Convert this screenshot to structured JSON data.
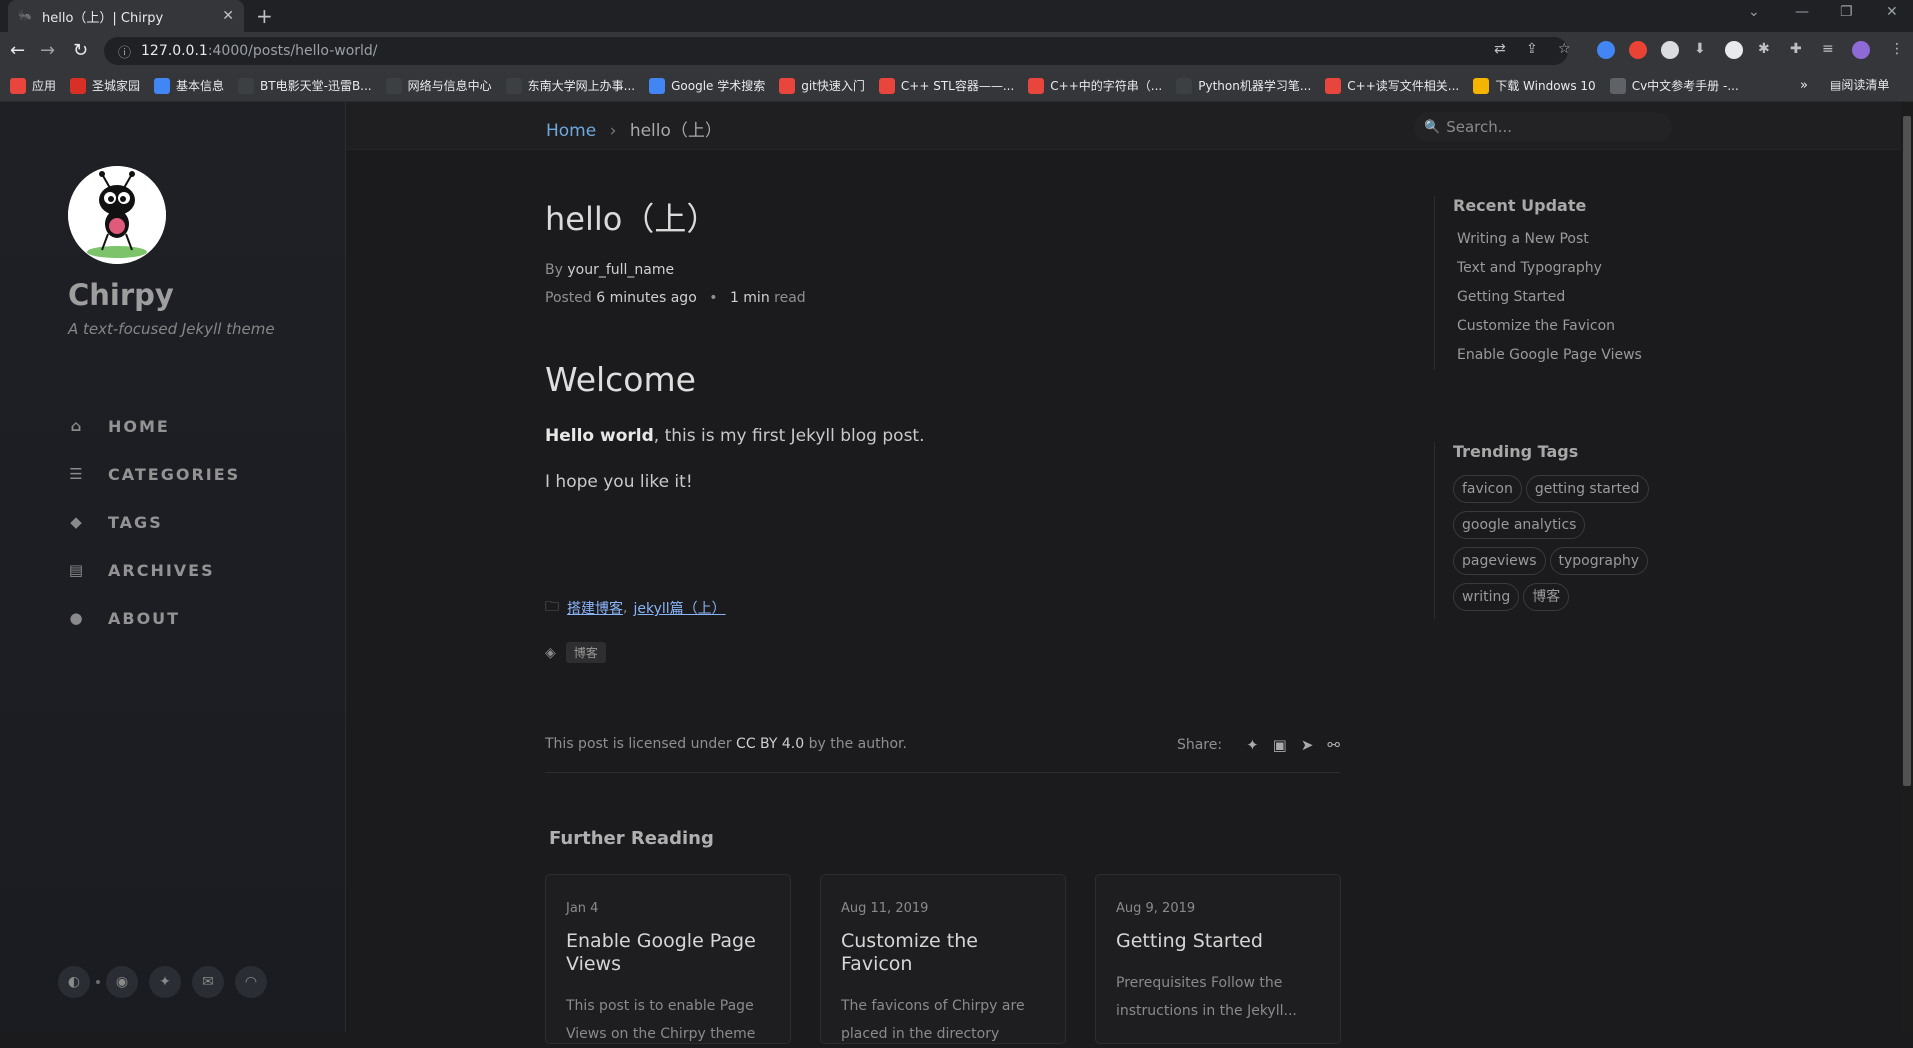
{
  "browser": {
    "tab_title": "hello（上）| Chirpy",
    "url_host": "127.0.0.1",
    "url_path": ":4000/posts/hello-world/",
    "bookmarks": [
      {
        "label": "应用",
        "color": "#e8453c"
      },
      {
        "label": "圣城家园",
        "color": "#d93025"
      },
      {
        "label": "基本信息",
        "color": "#4285f4"
      },
      {
        "label": "BT电影天堂-迅雷B...",
        "color": "#3c4043"
      },
      {
        "label": "网络与信息中心",
        "color": "#3c4043"
      },
      {
        "label": "东南大学网上办事...",
        "color": "#3c4043"
      },
      {
        "label": "Google 学术搜索",
        "color": "#4285f4"
      },
      {
        "label": "git快速入门",
        "color": "#e8453c"
      },
      {
        "label": "C++ STL容器——...",
        "color": "#e8453c"
      },
      {
        "label": "C++中的字符串（...",
        "color": "#e8453c"
      },
      {
        "label": "Python机器学习笔...",
        "color": "#3c4043"
      },
      {
        "label": "C++读写文件相关...",
        "color": "#e8453c"
      },
      {
        "label": "下载 Windows 10",
        "color": "#f4b400"
      },
      {
        "label": "Cv中文参考手册 -...",
        "color": "#5f6368"
      }
    ],
    "bookmarks_more": "»",
    "reading_list": "阅读清单"
  },
  "sidebar": {
    "site_title": "Chirpy",
    "site_subtitle": "A text-focused Jekyll theme",
    "nav": [
      {
        "label": "HOME",
        "icon": "home-icon"
      },
      {
        "label": "CATEGORIES",
        "icon": "stream-icon"
      },
      {
        "label": "TAGS",
        "icon": "tag-icon"
      },
      {
        "label": "ARCHIVES",
        "icon": "archive-icon"
      },
      {
        "label": "ABOUT",
        "icon": "info-icon"
      }
    ]
  },
  "topbar": {
    "breadcrumb_home": "Home",
    "breadcrumb_current": "hello（上）",
    "search_placeholder": "Search..."
  },
  "post": {
    "title": "hello（上）",
    "by_label": "By",
    "author": "your_full_name",
    "posted_label": "Posted",
    "posted_time": "6 minutes ago",
    "read_time": "1 min",
    "read_label": "read",
    "heading": "Welcome",
    "p1_bold": "Hello world",
    "p1_rest": ", this is my first Jekyll blog post.",
    "p2": "I hope you like it!",
    "categories": [
      "搭建博客",
      "jekyll篇（上）"
    ],
    "tags": [
      "博客"
    ],
    "license_pre": "This post is licensed under ",
    "license_name": "CC BY 4.0",
    "license_post": " by the author.",
    "share_label": "Share:"
  },
  "further": {
    "heading": "Further Reading",
    "cards": [
      {
        "date": "Jan 4",
        "title": "Enable Google Page Views",
        "excerpt": "This post is to enable Page Views on the Chirpy theme"
      },
      {
        "date": "Aug 11, 2019",
        "title": "Customize the Favicon",
        "excerpt": "The favicons of Chirpy are placed in the directory"
      },
      {
        "date": "Aug 9, 2019",
        "title": "Getting Started",
        "excerpt": "Prerequisites Follow the instructions in the Jekyll..."
      }
    ]
  },
  "panel": {
    "recent_heading": "Recent Update",
    "recent": [
      "Writing a New Post",
      "Text and Typography",
      "Getting Started",
      "Customize the Favicon",
      "Enable Google Page Views"
    ],
    "trending_heading": "Trending Tags",
    "trending": [
      "favicon",
      "getting started",
      "google analytics",
      "pageviews",
      "typography",
      "writing",
      "博客"
    ]
  },
  "colors": {
    "accent": "#8ab4f8",
    "sidebar_bg": "#1f2026",
    "page_bg": "#1b1b1e"
  }
}
